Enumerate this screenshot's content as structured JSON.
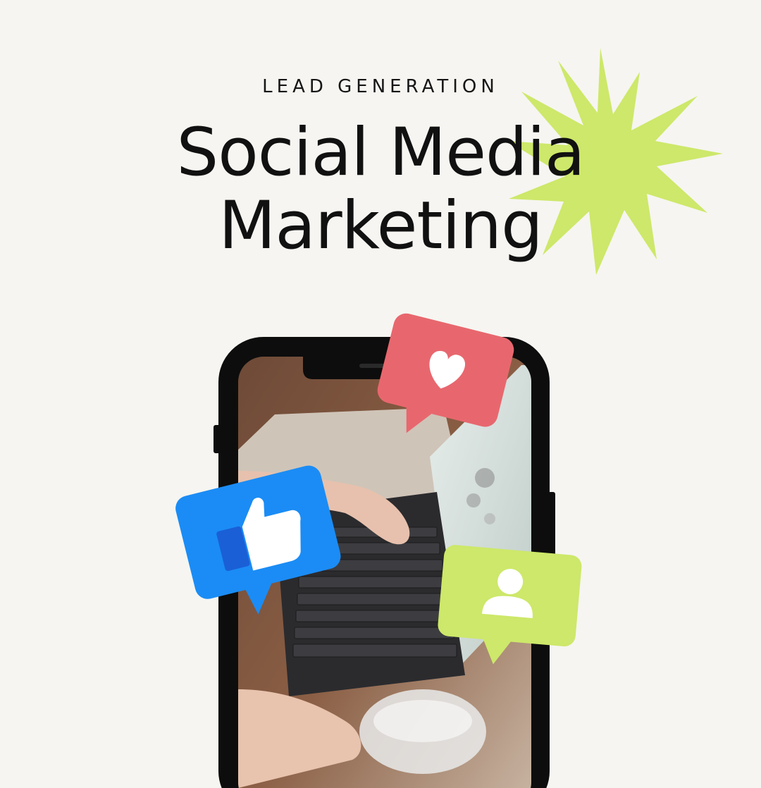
{
  "header": {
    "kicker": "LEAD GENERATION",
    "title_line1": "Social Media",
    "title_line2": "Marketing"
  },
  "colors": {
    "background": "#f6f5f1",
    "accent_starburst": "#cde86a",
    "heart_bubble": "#e8676e",
    "like_bubble": "#1b8cf5",
    "profile_bubble": "#cde86a",
    "phone_frame": "#0d0d0d"
  },
  "icons": [
    "starburst-shape",
    "heart-icon",
    "thumbs-up-icon",
    "profile-icon"
  ]
}
